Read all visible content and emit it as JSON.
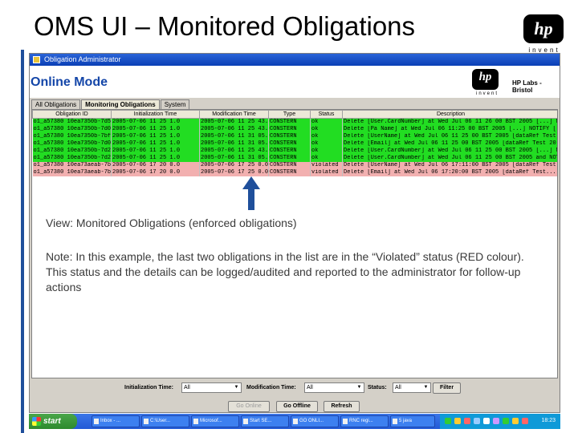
{
  "slide": {
    "title": "OMS UI – Monitored Obligations",
    "hp_logo": "hp",
    "hp_invent": "invent"
  },
  "window": {
    "title": "Obligation Administrator",
    "mode_title": "Online Mode",
    "hp_logo": "hp",
    "hp_invent": "invent",
    "lab_label": "HP Labs - Bristol"
  },
  "tabs": [
    {
      "label": "All Obligations",
      "active": false
    },
    {
      "label": "Monitoring Obligations",
      "active": true
    },
    {
      "label": "System",
      "active": false
    }
  ],
  "table": {
    "columns": [
      "Obligation ID",
      "Initialization Time",
      "Modification Time",
      "Type",
      "Status",
      "Description"
    ],
    "rows": [
      {
        "id": "o1_a57380 10ea7350b-7d59",
        "init": "2005-07-06 11 25 1.0",
        "mod": "2005-07-06 11 25 43.0",
        "type": "CONSTERN",
        "status": "ok",
        "desc": "Delete [User.CardNumber] at Wed Jul 06 11 26 00 BST 2005 [...] NO...",
        "state": "ok"
      },
      {
        "id": "o1_a57380 10ea7350b-7d0c",
        "init": "2005-07-06 11 25 1.0",
        "mod": "2005-07-06 11 25 43.0",
        "type": "CONSTERN",
        "status": "ok",
        "desc": "Delete [Pa Name] at Wed Jul 06 11:25 00 BST 2005 [...] NOTIFY [...] NO...",
        "state": "ok"
      },
      {
        "id": "o1_a57380 10ea7350b-7bf5",
        "init": "2005-07-06 11 25 1.0",
        "mod": "2005-07-06 11 31 05.0",
        "type": "CONSTERN",
        "status": "ok",
        "desc": "Delete [UserName] at Wed Jul 06 11 25 00 BST 2005 [dataRef Test 20...",
        "state": "ok"
      },
      {
        "id": "o1_a57380 10ea7350b-7d0b",
        "init": "2005-07-06 11 25 1.0",
        "mod": "2005-07-06 11 31 05.0",
        "type": "CONSTERN",
        "status": "ok",
        "desc": "Delete [Email] at Wed Jul 06 11 25 00 BST 2005 [dataRef Test 20...",
        "state": "ok"
      },
      {
        "id": "o1_a57380 10ea7350b-7d29",
        "init": "2005-07-06 11 25 1.0",
        "mod": "2005-07-06 11 25 43.0",
        "type": "CONSTERN",
        "status": "ok",
        "desc": "Delete [User.CardNumber] at Wed Jul 06 11 25 00 BST 2005 [...] NO...",
        "state": "ok"
      },
      {
        "id": "o1_a57380 10ea7350b-7d2b",
        "init": "2005-07-06 11 25 1.0",
        "mod": "2005-07-06 11 31 05.0",
        "type": "CONSTERN",
        "status": "ok",
        "desc": "Delete [User.CardNumber] at Wed Jul 06 11 25 00 BST 2005 and NOTIFY [...]",
        "state": "ok"
      },
      {
        "id": "o1_a57380 10ea73aeab-7b71",
        "init": "2005-07-06 17 20 0.0",
        "mod": "2005-07-06 17 25 0.0",
        "type": "CONSTERN",
        "status": "violated",
        "desc": "Delete [UserName] at Wed Jul 06 17:11:00 BST 2005 [dataRef Test 20...",
        "state": "violated"
      },
      {
        "id": "o1_a57380 10ea73aeab-7b70",
        "init": "2005-07-06 17 20 0.0",
        "mod": "2005-07-06 17 25 0.0",
        "type": "CONSTERN",
        "status": "violated",
        "desc": "Delete [Email] at Wed Jul 06 17:20:00 BST 2005 [dataRef Test...",
        "state": "violated"
      }
    ]
  },
  "annotations": {
    "view": "View: Monitored Obligations (enforced obligations)",
    "note": "Note: In this example, the last two obligations in the list are in the “Violated” status (RED colour). This status and the details can be logged/audited and reported to the administrator for follow-up actions"
  },
  "filters": {
    "init_label": "Initialization Time:",
    "init_value": "All",
    "mod_label": "Modification Time:",
    "mod_value": "All",
    "status_label": "Status:",
    "status_value": "All",
    "filter_button": "Filter"
  },
  "buttons": {
    "go_online": "Go Online",
    "go_offline": "Go Offline",
    "refresh": "Refresh"
  },
  "taskbar": {
    "start": "start",
    "items": [
      "Inbox - ...",
      "C:\\User...",
      "Microsof...",
      "Start SE...",
      "GO ONLI...",
      "RNC regi...",
      "5 java"
    ],
    "clock": "18:23"
  },
  "colors": {
    "accent_blue": "#1f4f9b",
    "ok_green": "#22dd22",
    "violated_red": "#f2b0b0"
  }
}
